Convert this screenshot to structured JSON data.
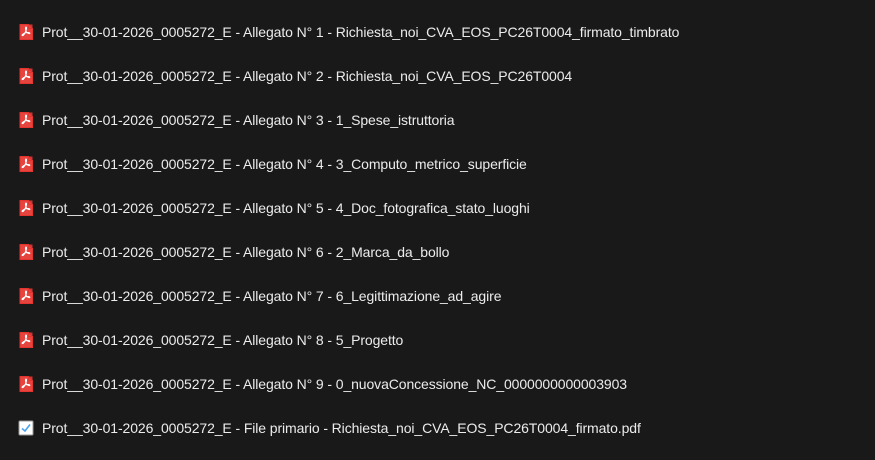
{
  "file_list": {
    "items": [
      {
        "name": "Prot__30-01-2026_0005272_E - Allegato N° 1 - Richiesta_noi_CVA_EOS_PC26T0004_firmato_timbrato",
        "icon": "pdf-icon"
      },
      {
        "name": "Prot__30-01-2026_0005272_E - Allegato N° 2 - Richiesta_noi_CVA_EOS_PC26T0004",
        "icon": "pdf-icon"
      },
      {
        "name": "Prot__30-01-2026_0005272_E - Allegato N° 3 - 1_Spese_istruttoria",
        "icon": "pdf-icon"
      },
      {
        "name": "Prot__30-01-2026_0005272_E - Allegato N° 4 - 3_Computo_metrico_superficie",
        "icon": "pdf-icon"
      },
      {
        "name": "Prot__30-01-2026_0005272_E - Allegato N° 5 - 4_Doc_fotografica_stato_luoghi",
        "icon": "pdf-icon"
      },
      {
        "name": "Prot__30-01-2026_0005272_E - Allegato N° 6 - 2_Marca_da_bollo",
        "icon": "pdf-icon"
      },
      {
        "name": "Prot__30-01-2026_0005272_E - Allegato N° 7 - 6_Legittimazione_ad_agire",
        "icon": "pdf-icon"
      },
      {
        "name": "Prot__30-01-2026_0005272_E - Allegato N° 8 - 5_Progetto",
        "icon": "pdf-icon"
      },
      {
        "name": "Prot__30-01-2026_0005272_E - Allegato N° 9 - 0_nuovaConcessione_NC_0000000000003903",
        "icon": "pdf-icon"
      },
      {
        "name": "Prot__30-01-2026_0005272_E - File primario - Richiesta_noi_CVA_EOS_PC26T0004_firmato.pdf",
        "icon": "signed-document-icon"
      }
    ]
  },
  "colors": {
    "background": "#191919",
    "text": "#ececec",
    "pdf_icon": "#e3342f",
    "signed_icon": "#4aa3f0"
  }
}
